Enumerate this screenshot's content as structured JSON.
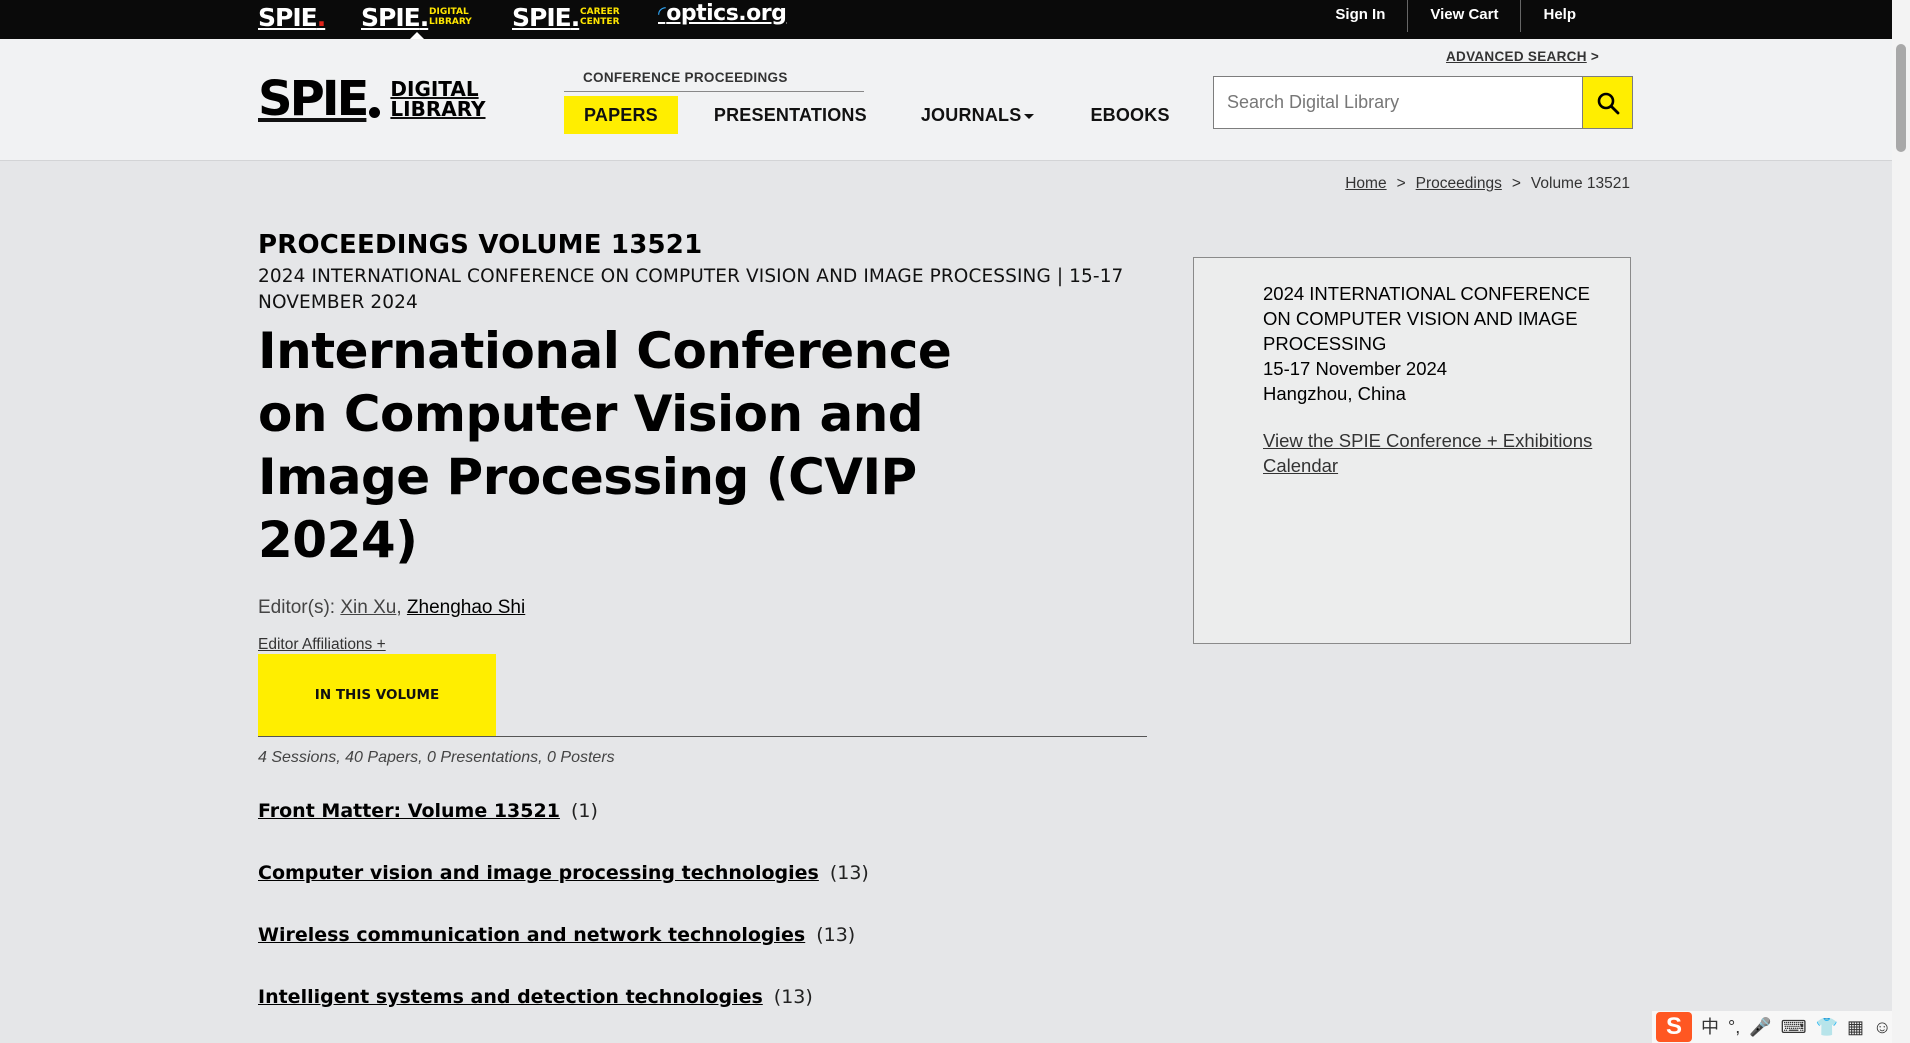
{
  "topbar": {
    "brands": {
      "spie": "SPIE",
      "dl": "SPIE",
      "dl_sub1": "DIGITAL",
      "dl_sub2": "LIBRARY",
      "cc": "SPIE",
      "cc_sub1": "CAREER",
      "cc_sub2": "CENTER",
      "optics": "optics.org"
    },
    "links": {
      "sign_in": "Sign In",
      "view_cart": "View Cart",
      "help": "Help"
    }
  },
  "header": {
    "logo_big": "SPIE",
    "logo_small1": "DIGITAL",
    "logo_small2": "LIBRARY",
    "advanced_search": "ADVANCED SEARCH",
    "advanced_search_arrow": ">",
    "nav_group_label": "CONFERENCE PROCEEDINGS",
    "nav": {
      "papers": "PAPERS",
      "presentations": "PRESENTATIONS",
      "journals": "JOURNALS",
      "ebooks": "EBOOKS"
    },
    "search_placeholder": "Search Digital Library"
  },
  "breadcrumb": {
    "home": "Home",
    "proceedings": "Proceedings",
    "current": "Volume 13521",
    "sep": ">"
  },
  "main": {
    "volume": "PROCEEDINGS VOLUME 13521",
    "conference": "2024 INTERNATIONAL CONFERENCE ON COMPUTER VISION AND IMAGE PROCESSING | 15-17 NOVEMBER 2024",
    "title": "International Conference on Computer Vision and Image Processing (CVIP 2024)",
    "editors_label": "Editor(s):",
    "editor1": "Xin Xu",
    "editor2": "Zhenghao Shi",
    "affiliations": "Editor Affiliations +",
    "tab": "IN THIS VOLUME",
    "counts": "4 Sessions, 40 Papers, 0 Presentations, 0 Posters",
    "sessions": [
      {
        "title": "Front Matter: Volume 13521",
        "count": "(1)"
      },
      {
        "title": "Computer vision and image processing technologies",
        "count": "(13)"
      },
      {
        "title": "Wireless communication and network technologies",
        "count": "(13)"
      },
      {
        "title": "Intelligent systems and detection technologies",
        "count": "(13)"
      }
    ]
  },
  "sidebar": {
    "line1": "2024 INTERNATIONAL CONFERENCE ON COMPUTER VISION AND IMAGE PROCESSING",
    "dates": "15-17 November 2024",
    "location": "Hangzhou, China",
    "calendar_link": "View the SPIE Conference + Exhibitions Calendar"
  },
  "tray": {
    "logo": "S",
    "lang": "中",
    "punct": "°,"
  },
  "colors": {
    "accent_yellow": "#ffee00",
    "topbar_black": "#0a0a0a",
    "page_bg": "#e5e6e8"
  }
}
